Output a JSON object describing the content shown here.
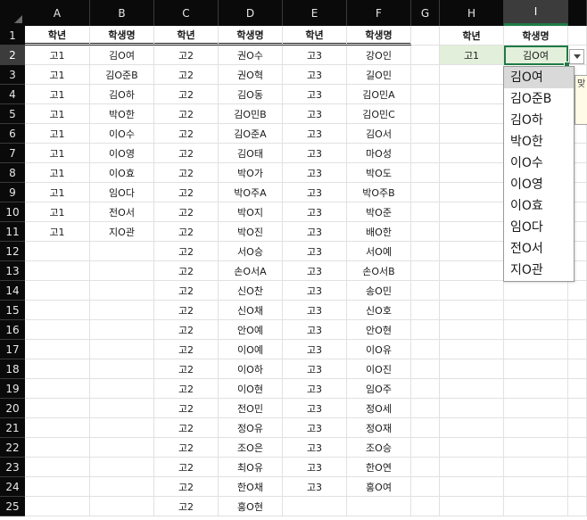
{
  "columns": [
    "A",
    "B",
    "C",
    "D",
    "E",
    "F",
    "G",
    "H",
    "I"
  ],
  "row_numbers": [
    "1",
    "2",
    "3",
    "4",
    "5",
    "6",
    "7",
    "8",
    "9",
    "10",
    "11",
    "12",
    "13",
    "14",
    "15",
    "16",
    "17",
    "18",
    "19",
    "20",
    "21",
    "22",
    "23",
    "24",
    "25"
  ],
  "headers": {
    "A": "학년",
    "B": "학생명",
    "C": "학년",
    "D": "학생명",
    "E": "학년",
    "F": "학생명",
    "H": "학년",
    "I": "학생명"
  },
  "grade1": {
    "grade": [
      "고1",
      "고1",
      "고1",
      "고1",
      "고1",
      "고1",
      "고1",
      "고1",
      "고1",
      "고1"
    ],
    "names": [
      "김O여",
      "김O준B",
      "김O하",
      "박O한",
      "이O수",
      "이O영",
      "이O효",
      "임O다",
      "전O서",
      "지O관"
    ]
  },
  "grade2": {
    "grade": [
      "고2",
      "고2",
      "고2",
      "고2",
      "고2",
      "고2",
      "고2",
      "고2",
      "고2",
      "고2",
      "고2",
      "고2",
      "고2",
      "고2",
      "고2",
      "고2",
      "고2",
      "고2",
      "고2",
      "고2",
      "고2",
      "고2",
      "고2",
      "고2"
    ],
    "names": [
      "권O수",
      "권O혁",
      "김O동",
      "김O민B",
      "김O준A",
      "김O태",
      "박O가",
      "박O주A",
      "박O지",
      "박O진",
      "서O승",
      "손O서A",
      "신O찬",
      "신O채",
      "안O예",
      "이O예",
      "이O하",
      "이O현",
      "전O민",
      "정O유",
      "조O은",
      "최O유",
      "한O채",
      "홍O현"
    ]
  },
  "grade3": {
    "grade": [
      "고3",
      "고3",
      "고3",
      "고3",
      "고3",
      "고3",
      "고3",
      "고3",
      "고3",
      "고3",
      "고3",
      "고3",
      "고3",
      "고3",
      "고3",
      "고3",
      "고3",
      "고3",
      "고3",
      "고3",
      "고3",
      "고3",
      "고3"
    ],
    "names": [
      "강O인",
      "길O민",
      "김O민A",
      "김O민C",
      "김O서",
      "마O성",
      "박O도",
      "박O주B",
      "박O준",
      "배O한",
      "서O예",
      "손O서B",
      "송O민",
      "신O호",
      "안O현",
      "이O유",
      "이O진",
      "임O주",
      "정O세",
      "정O재",
      "조O승",
      "한O연",
      "홍O여"
    ]
  },
  "lookup": {
    "grade": "고1",
    "name": "김O여"
  },
  "dropdown": {
    "items": [
      "김O여",
      "김O준B",
      "김O하",
      "박O한",
      "이O수",
      "이O영",
      "이O효",
      "임O다",
      "전O서",
      "지O관"
    ],
    "highlighted": "김O여"
  },
  "tooltip_text": "맞 주",
  "colors": {
    "header_bg": "#0a0a0a",
    "selection": "#1f7a45",
    "lookup_fill": "#e2efda"
  }
}
